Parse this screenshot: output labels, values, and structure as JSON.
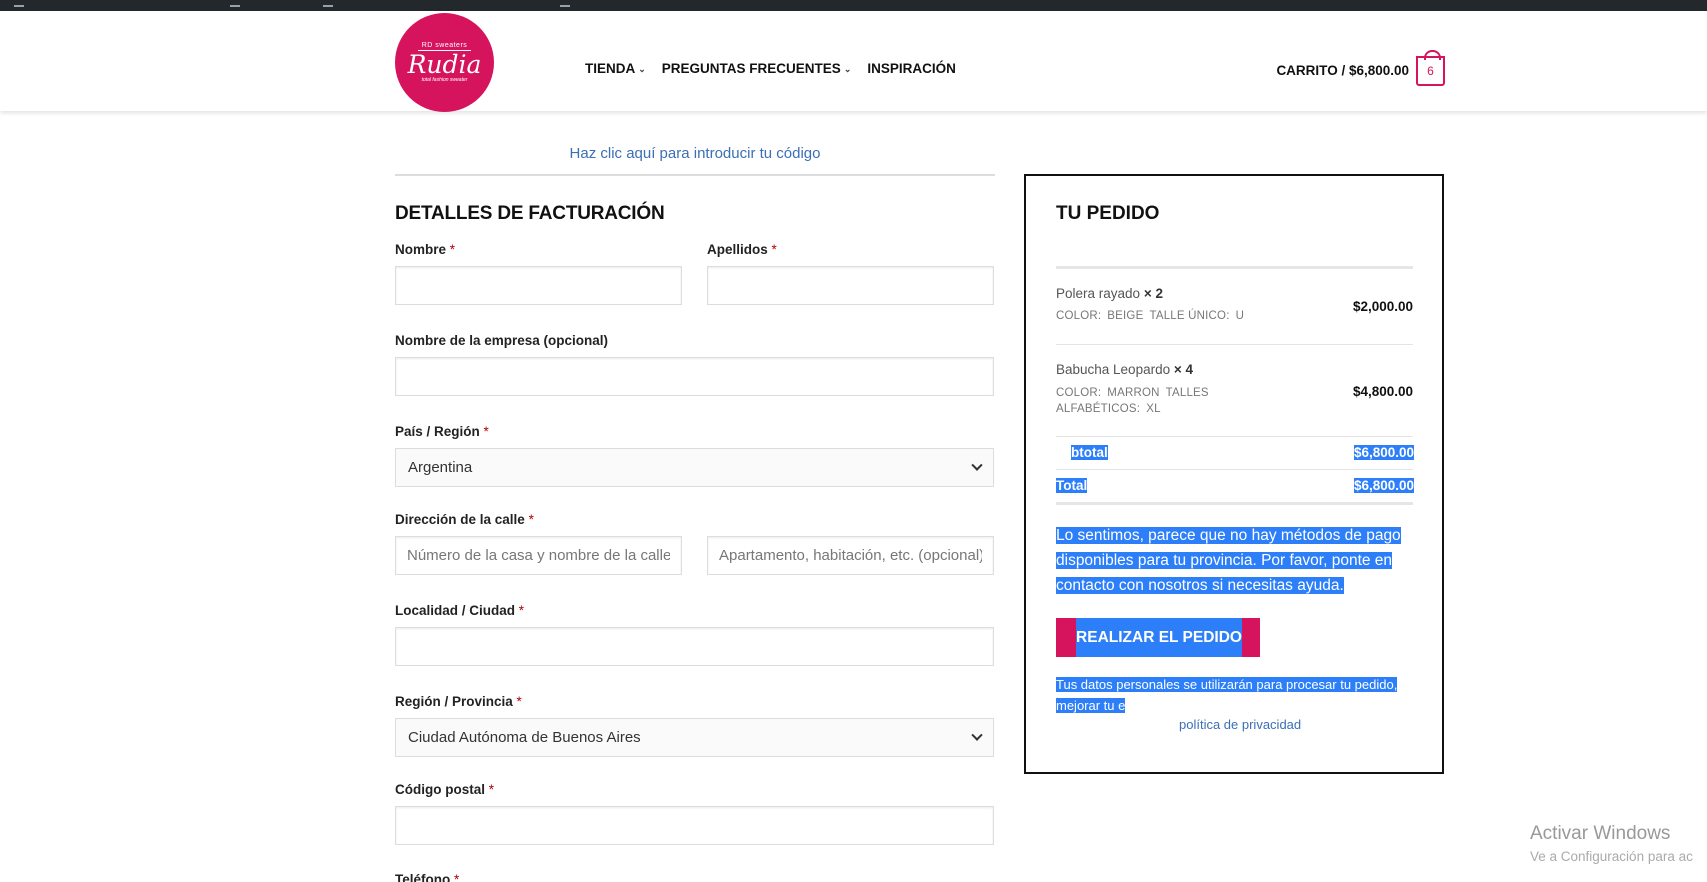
{
  "header": {
    "logo": {
      "top": "RD sweaters",
      "main": "Rudia",
      "sub": "total fashion sweater"
    },
    "nav": [
      {
        "label": "TIENDA",
        "has_dropdown": true
      },
      {
        "label": "PREGUNTAS FRECUENTES",
        "has_dropdown": true
      },
      {
        "label": "INSPIRACIÓN",
        "has_dropdown": false
      }
    ],
    "cart_label": "CARRITO / $6,800.00",
    "cart_count": "6",
    "cart_icon": "shopping-bag-icon"
  },
  "coupon_link": "Haz clic aquí para introducir tu código",
  "billing": {
    "title": "DETALLES DE FACTURACIÓN",
    "required_mark": "*",
    "first_name_label": "Nombre",
    "last_name_label": "Apellidos",
    "company_label": "Nombre de la empresa (opcional)",
    "country_label": "País / Región",
    "country_value": "Argentina",
    "street_label": "Dirección de la calle",
    "street_placeholder": "Número de la casa y nombre de la calle",
    "apartment_placeholder": "Apartamento, habitación, etc. (opcional)",
    "city_label": "Localidad / Ciudad",
    "region_label": "Región / Provincia",
    "region_value": "Ciudad Autónoma de Buenos Aires",
    "postcode_label": "Código postal",
    "phone_label": "Teléfono"
  },
  "order": {
    "title": "TU PEDIDO",
    "items": [
      {
        "name": "Polera rayado",
        "qty": "× 2",
        "meta": [
          "COLOR:",
          "BEIGE",
          "TALLE ÚNICO:",
          "U"
        ],
        "price": "$2,000.00"
      },
      {
        "name": "Babucha Leopardo",
        "qty": "× 4",
        "meta": [
          "COLOR:",
          "MARRON",
          "TALLES ALFABÉTICOS:",
          "XL"
        ],
        "price": "$4,800.00"
      }
    ],
    "subtotal_label": "btotal",
    "subtotal_value": "$6,800.00",
    "total_label": "Total",
    "total_value": "$6,800.00",
    "notice": "Lo sentimos, parece que no hay métodos de pago disponibles para tu provincia. Por favor, ponte en contacto con nosotros si necesitas ayuda.",
    "place_order_label": "REALIZAR EL PEDIDO",
    "privacy_text": "Tus datos personales se utilizarán para procesar tu pedido, mejorar tu e",
    "privacy_link": "política de privacidad"
  },
  "watermark": {
    "line1": "Activar Windows",
    "line2": "Ve a Configuración para ac"
  },
  "colors": {
    "brand": "#d6145e",
    "link": "#3b6fb6",
    "selection": "#2d7ff9"
  }
}
